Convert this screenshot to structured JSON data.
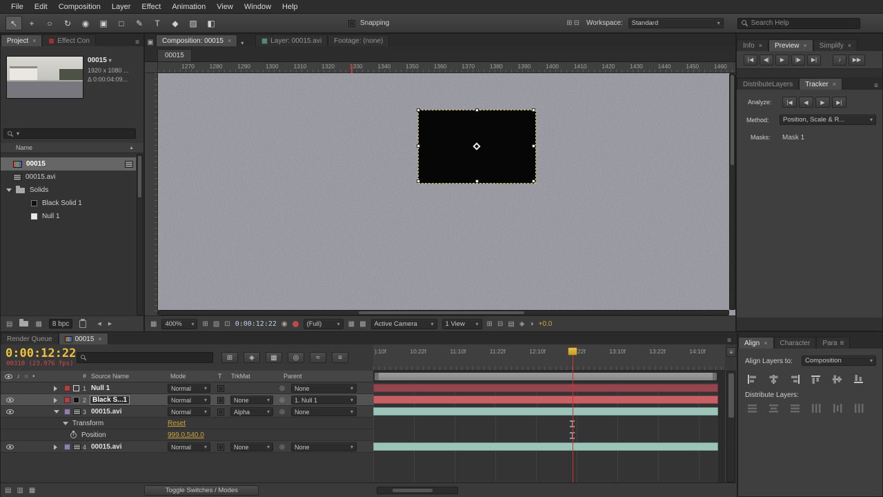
{
  "glyphs": {
    "close": "×",
    "panel_menu": "≡"
  },
  "menubar": {
    "items": [
      "File",
      "Edit",
      "Composition",
      "Layer",
      "Effect",
      "Animation",
      "View",
      "Window",
      "Help"
    ]
  },
  "toolbar": {
    "tools": [
      "↖",
      "+",
      "○",
      "↻",
      "◉",
      "▣",
      "□",
      "✎",
      "T",
      "◆",
      "▨",
      "◧"
    ],
    "snapping_label": "Snapping",
    "workspace_icons": [
      "⊞",
      "⊟"
    ],
    "workspace_label": "Workspace:",
    "workspace_value": "Standard",
    "search_placeholder": "Search Help"
  },
  "project": {
    "tab_project": "Project",
    "tab_effects": "Effect Con",
    "selected_item": {
      "title": "00015",
      "meta1": "1920 x 1080 ...",
      "meta2": "Δ 0:00:04:09..."
    },
    "name_header": "Name",
    "rows": [
      {
        "label": "00015"
      },
      {
        "label": "00015.avi"
      },
      {
        "label": "Solids"
      },
      {
        "label": "Black Solid 1"
      },
      {
        "label": "Null 1"
      }
    ],
    "footer_icons": [
      "▤",
      "▦",
      "◀",
      "▶"
    ],
    "footer_bpc": "8 bpc"
  },
  "viewer": {
    "tab_composition": "Composition: 00015",
    "tab_layer": "Layer: 00015.avi",
    "tab_footage": "Footage: (none)",
    "crumb": "00015",
    "ruler_ticks": [
      "1270",
      "1280",
      "1290",
      "1300",
      "1310",
      "1320",
      "1330",
      "1340",
      "1350",
      "1360",
      "1370",
      "1380",
      "1390",
      "1400",
      "1410",
      "1420",
      "1430",
      "1440",
      "1450",
      "1460"
    ],
    "footer_icons": [
      "▦",
      "⊞",
      "▧",
      "⊡",
      "◉",
      "▦",
      "▩",
      "⊞",
      "⊟",
      "▤",
      "◈",
      "◑"
    ],
    "footer": {
      "zoom": "400%",
      "timecode": "0:00:12:22",
      "resolution": "(Full)",
      "camera": "Active Camera",
      "view": "1 View",
      "exposure": "+0.0"
    }
  },
  "right": {
    "tabs": [
      "Info",
      "Preview",
      "Simplify"
    ],
    "transport": [
      "|◀",
      "◀|",
      "▶",
      "|▶",
      "▶|",
      "♪",
      "▶▶"
    ],
    "tracker_tabs": [
      "DistributeLayers",
      "Tracker"
    ],
    "analyze_label": "Analyze:",
    "analyze_buttons": [
      "|◀",
      "◀",
      "▶",
      "▶|"
    ],
    "method_label": "Method:",
    "method_value": "Position, Scale & R...",
    "masks_label": "Masks:",
    "masks_value": "Mask 1"
  },
  "timeline": {
    "tab_render_queue": "Render Queue",
    "tab_comp": "00015",
    "timecode": "0:00:12:22",
    "frame_info": "00310 (23.976 fps)",
    "buttons": [
      "⊞",
      "◈",
      "▦",
      "◎",
      "≈",
      "≡"
    ],
    "header_icons": [
      "♪",
      "○",
      "▪"
    ],
    "headers": {
      "num": "#",
      "source": "Source Name",
      "mode": "Mode",
      "t": "T",
      "trkmat": "TrkMat",
      "parent": "Parent"
    },
    "layers": [
      {
        "num": "1",
        "name": "Null 1",
        "mode": "Normal",
        "parent": "None"
      },
      {
        "num": "2",
        "name": "Black S...1",
        "mode": "Normal",
        "trkmat": "None",
        "parent": "1. Null 1"
      },
      {
        "num": "3",
        "name": "00015.avi",
        "mode": "Normal",
        "trkmat": "Alpha",
        "parent": "None"
      },
      {
        "num": "4",
        "name": "00015.avi",
        "mode": "Normal",
        "trkmat": "None",
        "parent": "None"
      }
    ],
    "transform_label": "Transform",
    "transform_reset": "Reset",
    "position_label": "Position",
    "position_value": "999.0,540.0",
    "ruler_ticks": [
      "):10f",
      "10:22f",
      "11:10f",
      "11:22f",
      "12:10f",
      "12:22f",
      "13:10f",
      "13:22f",
      "14:10f"
    ],
    "pane_toggles": [
      "▤",
      "▥",
      "▦"
    ],
    "toggle_button": "Toggle Switches / Modes"
  },
  "align": {
    "tabs": [
      "Align",
      "Character",
      "Para"
    ],
    "align_to_label": "Align Layers to:",
    "align_to_value": "Composition",
    "distribute_label": "Distribute Layers:"
  }
}
